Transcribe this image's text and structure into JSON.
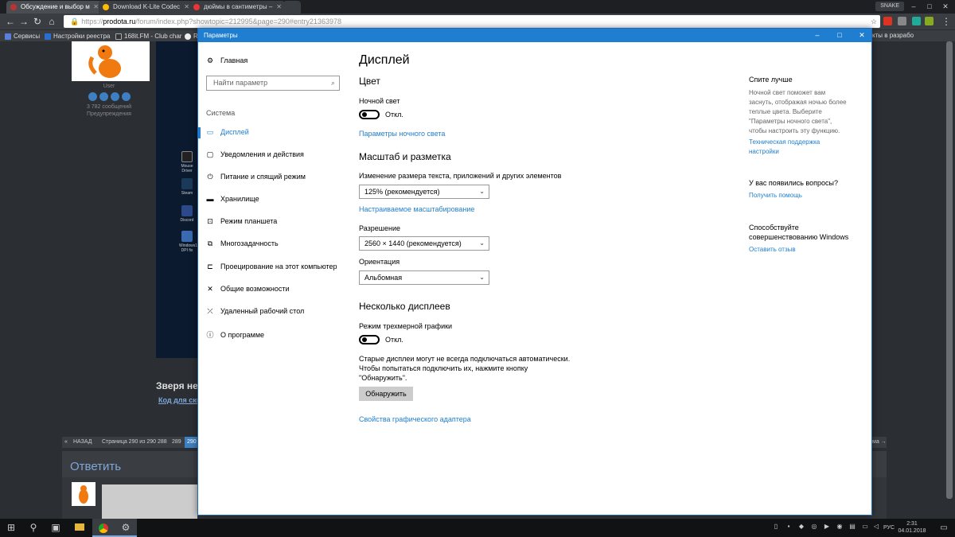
{
  "chrome": {
    "tabs": [
      {
        "title": "Обсуждение и выбор м",
        "favicon_color": "#b33"
      },
      {
        "title": "Download K-Lite Codec",
        "favicon_color": "#fb0"
      },
      {
        "title": "дюймы в сантиметры –",
        "favicon_color": "#e33"
      }
    ],
    "profile": "SNAKE",
    "url_prefix": "https://",
    "url_host": "prodota.ru",
    "url_path": "/forum/index.php?showtopic=212995&page=290#entry21363978",
    "bookmarks": [
      {
        "label": "Сервисы",
        "icon_color": "#5a7fd8"
      },
      {
        "label": "Настройки реестра",
        "icon_color": "#2a6fd0"
      },
      {
        "label": "168it.FM - Club char",
        "icon_color": "#333"
      },
      {
        "label": "R",
        "icon_color": "#eee"
      }
    ],
    "bookmark_overflow": "кты в разрабо"
  },
  "forum": {
    "user": "User",
    "messages": "3 782 сообщений",
    "warnings": "Предупреждения",
    "desktop_icons": [
      "Mouse Driver",
      "Steam",
      "Discord",
      "Windows10 DPI fix"
    ],
    "zverya": "Зверя нет",
    "kod": "Код для скид",
    "pager": {
      "back": "НАЗАД",
      "page_info": "Страница 290 из 290",
      "pages": [
        "288",
        "289",
        "290"
      ],
      "next": "ма →"
    },
    "reply_title": "Ответить"
  },
  "settings": {
    "window_title": "Параметры",
    "home": "Главная",
    "search_placeholder": "Найти параметр",
    "group": "Система",
    "nav": [
      {
        "label": "Дисплей",
        "icon": "display-icon",
        "glyph": "▭",
        "active": true
      },
      {
        "label": "Уведомления и действия",
        "icon": "notifications-icon",
        "glyph": "▢",
        "active": false
      },
      {
        "label": "Питание и спящий режим",
        "icon": "power-icon",
        "glyph": "⏻",
        "active": false
      },
      {
        "label": "Хранилище",
        "icon": "storage-icon",
        "glyph": "▬",
        "active": false
      },
      {
        "label": "Режим планшета",
        "icon": "tablet-icon",
        "glyph": "⊡",
        "active": false
      },
      {
        "label": "Многозадачность",
        "icon": "multitask-icon",
        "glyph": "⧉",
        "active": false
      },
      {
        "label": "Проецирование на этот компьютер",
        "icon": "project-icon",
        "glyph": "⊏",
        "active": false
      },
      {
        "label": "Общие возможности",
        "icon": "shared-icon",
        "glyph": "✕",
        "active": false
      },
      {
        "label": "Удаленный рабочий стол",
        "icon": "remote-icon",
        "glyph": "⤫",
        "active": false
      },
      {
        "label": "О программе",
        "icon": "info-icon",
        "glyph": "ⓘ",
        "active": false
      }
    ],
    "content": {
      "title": "Дисплей",
      "color_heading": "Цвет",
      "night_light_label": "Ночной свет",
      "night_light_state": "Откл.",
      "night_light_settings": "Параметры ночного света",
      "scale_heading": "Масштаб и разметка",
      "scale_label": "Изменение размера текста, приложений и других элементов",
      "scale_value": "125% (рекомендуется)",
      "custom_scaling": "Настраиваемое масштабирование",
      "resolution_label": "Разрешение",
      "resolution_value": "2560 × 1440 (рекомендуется)",
      "orientation_label": "Ориентация",
      "orientation_value": "Альбомная",
      "multi_heading": "Несколько дисплеев",
      "stereo_label": "Режим трехмерной графики",
      "stereo_state": "Откл.",
      "old_displays_1": "Старые дисплеи могут не всегда подключаться автоматически.",
      "old_displays_2": "Чтобы попытаться подключить их, нажмите кнопку",
      "old_displays_3": "\"Обнаружить\".",
      "detect_button": "Обнаружить",
      "adapter_props": "Свойства графического адаптера"
    },
    "sidebar": {
      "sleep_title": "Спите лучше",
      "sleep_text": [
        "Ночной свет поможет вам",
        "заснуть, отображая ночью более",
        "теплые цвета. Выберите",
        "\"Параметры ночного света\",",
        "чтобы настроить эту функцию."
      ],
      "support_link": [
        "Техническая поддержка",
        "настройки"
      ],
      "questions_title": "У вас появились вопросы?",
      "get_help": "Получить помощь",
      "improve_title": [
        "Способствуйте",
        "совершенствованию Windows"
      ],
      "feedback": "Оставить отзыв"
    }
  },
  "taskbar": {
    "lang": "РУС",
    "time": "2:31",
    "date": "04.01.2018"
  },
  "colors": {
    "accent": "#1f7ed0",
    "taskbar": "#101214",
    "chrome": "#3a3d42"
  }
}
